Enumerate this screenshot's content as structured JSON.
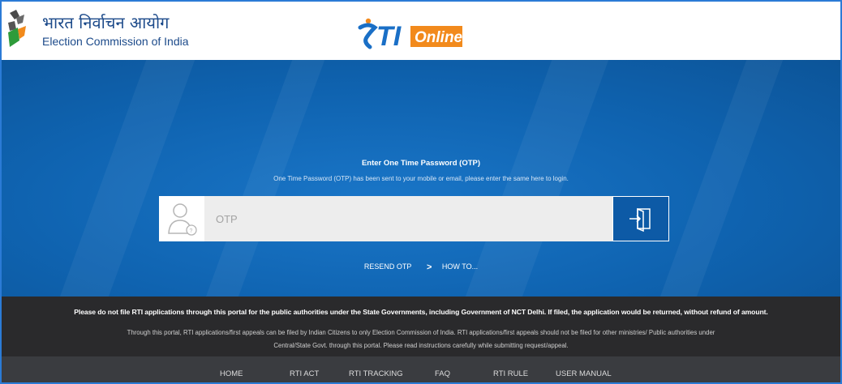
{
  "header": {
    "eci_hindi": "भारत निर्वाचन आयोग",
    "eci_english": "Election Commission of India",
    "rti_word": "TI",
    "online_word": "Online"
  },
  "otp": {
    "title": "Enter One Time Password (OTP)",
    "subtitle": "One Time Password (OTP) has been sent to your mobile or email, please enter the same here to login.",
    "placeholder": "OTP"
  },
  "links": {
    "resend": "RESEND OTP",
    "how_to": "HOW TO..."
  },
  "notice": {
    "bold": "Please do not file RTI applications through this portal for the public authorities under the State Governments, including Government of NCT Delhi. If filed, the application would be returned, without refund of amount.",
    "line1": "Through this portal, RTI applications/first appeals can be filed by Indian Citizens to only Election Commission of India. RTI applications/first appeals should not be filed for other ministries/ Public authorities under",
    "line2": "Central/State Govt. through this portal. Please read instructions carefully while submitting request/appeal."
  },
  "nav": {
    "items": [
      "HOME",
      "RTI ACT",
      "RTI TRACKING",
      "FAQ",
      "RTI RULE",
      "USER MANUAL"
    ]
  },
  "colors": {
    "hero_blue": "#0f63b0",
    "rti_blue": "#1a6fc6",
    "online_orange": "#f28a1c",
    "notice_bg": "#2a2a2c",
    "nav_bg": "#3a3c40"
  }
}
